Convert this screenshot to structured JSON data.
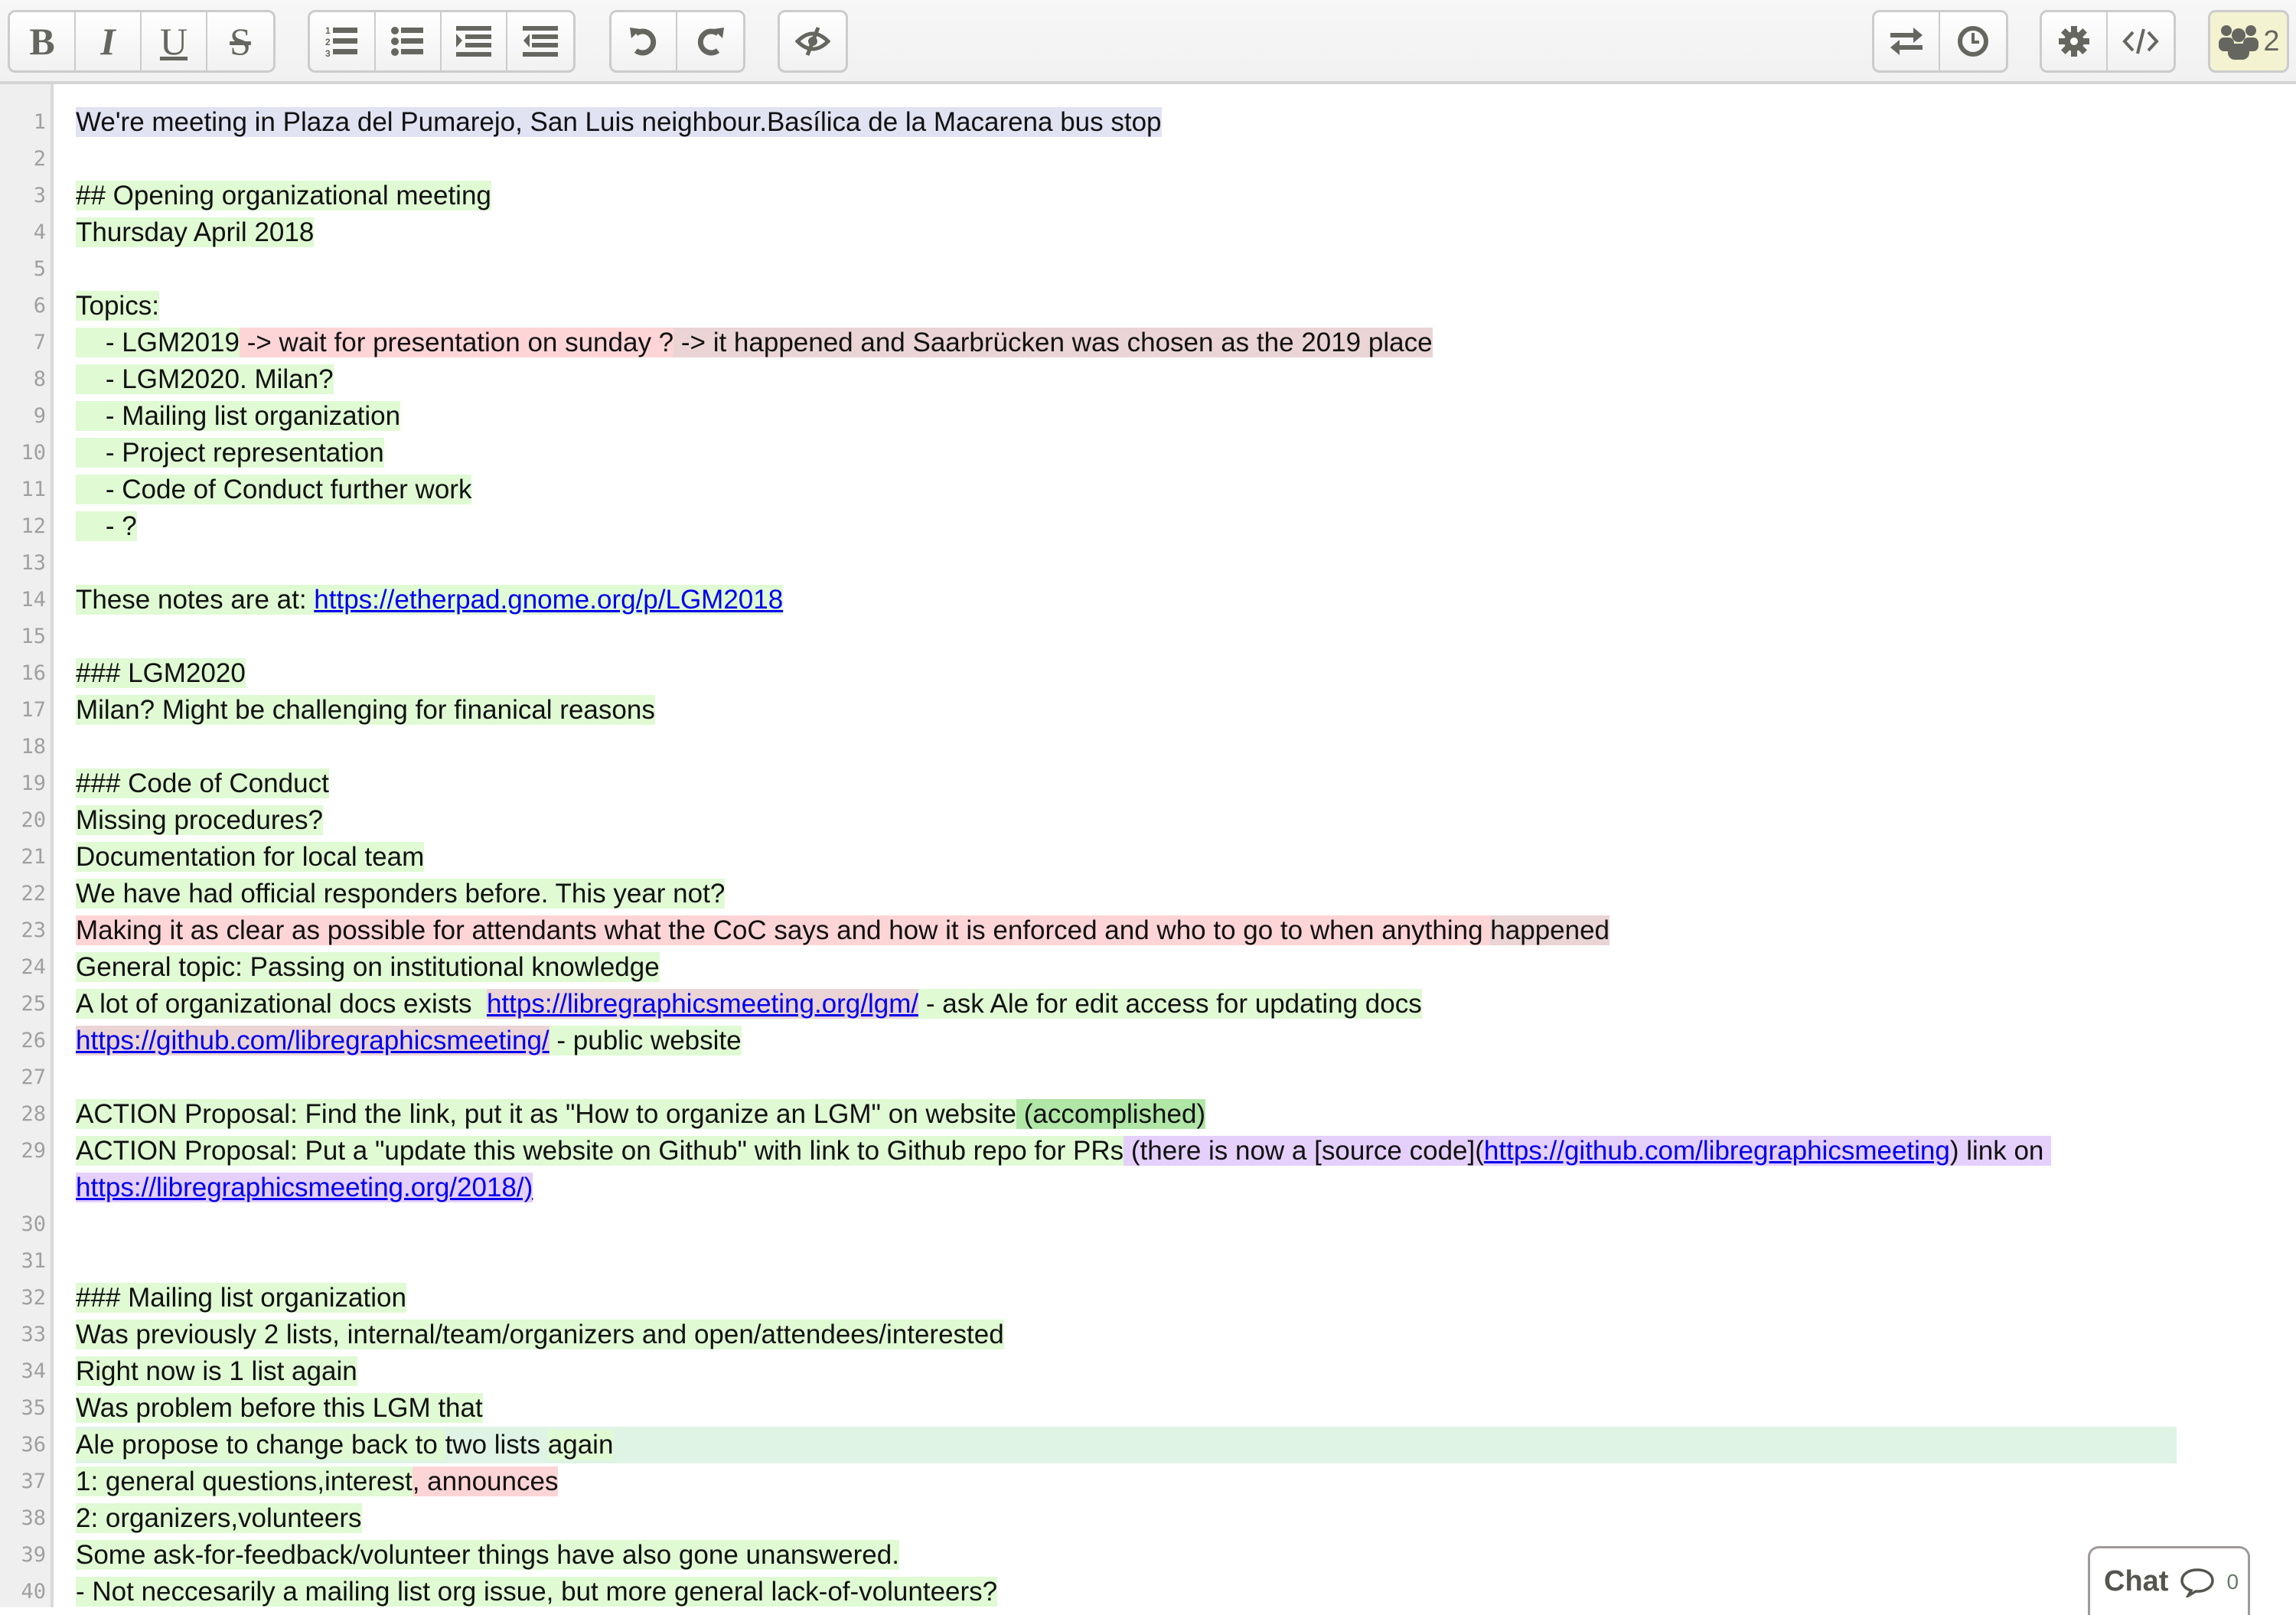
{
  "toolbar": {
    "bold_label": "B",
    "italic_label": "I",
    "underline_label": "U",
    "strike_label": "S",
    "users_count": "2",
    "left_buttons": [
      "bold",
      "italic",
      "underline",
      "strikethrough",
      "ordered-list",
      "unordered-list",
      "indent",
      "outdent",
      "undo",
      "redo",
      "clear-authorship"
    ],
    "right_buttons": [
      "import-export",
      "timeslider",
      "settings",
      "embed",
      "users"
    ]
  },
  "colors": {
    "author_blue": "#e1e2f2",
    "author_green": "#e0fad4",
    "author_pink": "#fed5d6",
    "author_mauve": "#ead4d6",
    "author_dark_green": "#b0e6a6",
    "author_violet": "#e5cffb",
    "author_mint": "#dff4e5",
    "link": "#0000ee"
  },
  "lines": [
    {
      "n": "1",
      "segs": [
        {
          "t": "We're meeting in Plaza del Pumarejo, San Luis neighbour.Basílica de la Macarena bus stop",
          "c": "blue"
        }
      ]
    },
    {
      "n": "2",
      "segs": []
    },
    {
      "n": "3",
      "segs": [
        {
          "t": "## Opening organizational meeting",
          "c": "green"
        }
      ]
    },
    {
      "n": "4",
      "segs": [
        {
          "t": "Thursday April 2018",
          "c": "green"
        }
      ]
    },
    {
      "n": "5",
      "segs": []
    },
    {
      "n": "6",
      "segs": [
        {
          "t": "Topics:",
          "c": "green"
        }
      ]
    },
    {
      "n": "7",
      "segs": [
        {
          "t": "    - LGM2019",
          "c": "green"
        },
        {
          "t": " -> wait for presentation on sunday ?",
          "c": "pink"
        },
        {
          "t": " -> it happened and Saarbrücken was chosen as the 2019 place",
          "c": "mauve"
        }
      ]
    },
    {
      "n": "8",
      "segs": [
        {
          "t": "    - LGM2020. Milan?",
          "c": "green"
        }
      ]
    },
    {
      "n": "9",
      "segs": [
        {
          "t": "    - Mailing list organization",
          "c": "green"
        }
      ]
    },
    {
      "n": "10",
      "segs": [
        {
          "t": "    - Project representation",
          "c": "green"
        }
      ]
    },
    {
      "n": "11",
      "segs": [
        {
          "t": "    - Code of Conduct further work",
          "c": "green"
        }
      ]
    },
    {
      "n": "12",
      "segs": [
        {
          "t": "    - ?",
          "c": "green"
        }
      ]
    },
    {
      "n": "13",
      "segs": []
    },
    {
      "n": "14",
      "segs": [
        {
          "t": "These notes are at: ",
          "c": "green"
        },
        {
          "t": "https://etherpad.gnome.org/p/LGM2018",
          "c": "green",
          "link": true
        }
      ]
    },
    {
      "n": "15",
      "segs": []
    },
    {
      "n": "16",
      "segs": [
        {
          "t": "### LGM2020",
          "c": "green"
        }
      ]
    },
    {
      "n": "17",
      "segs": [
        {
          "t": "Milan? Might be challenging for finanical reasons",
          "c": "green"
        }
      ]
    },
    {
      "n": "18",
      "segs": []
    },
    {
      "n": "19",
      "segs": [
        {
          "t": "### Code of Conduct",
          "c": "green"
        }
      ]
    },
    {
      "n": "20",
      "segs": [
        {
          "t": "Missing procedures?",
          "c": "green"
        }
      ]
    },
    {
      "n": "21",
      "segs": [
        {
          "t": "Documentation for local team",
          "c": "green"
        }
      ]
    },
    {
      "n": "22",
      "segs": [
        {
          "t": "We have had official responders before. This year not?",
          "c": "green"
        }
      ]
    },
    {
      "n": "23",
      "segs": [
        {
          "t": "Making it as clear as possible for attendants what the CoC says and how it is enforced and who to go to when anything ",
          "c": "pink"
        },
        {
          "t": "happened",
          "c": "mauve"
        }
      ]
    },
    {
      "n": "24",
      "segs": [
        {
          "t": "General topic: Passing on institutional knowledge",
          "c": "green"
        }
      ]
    },
    {
      "n": "25",
      "segs": [
        {
          "t": "A lot of organizational docs exists  ",
          "c": "green"
        },
        {
          "t": "https://libregraphicsmeeting.org/lgm/",
          "c": "mauve",
          "link": true
        },
        {
          "t": " - ask Ale for edit access for updating docs",
          "c": "green"
        }
      ]
    },
    {
      "n": "26",
      "segs": [
        {
          "t": "https://github.com/libregraphicsmeeting/",
          "c": "mauve",
          "link": true
        },
        {
          "t": " - public website",
          "c": "green"
        }
      ]
    },
    {
      "n": "27",
      "segs": []
    },
    {
      "n": "28",
      "segs": [
        {
          "t": "ACTION Proposal: Find the link, put it as \"How to organize an LGM\" on website",
          "c": "green"
        },
        {
          "t": " (accomplished)",
          "c": "dgreen"
        }
      ]
    },
    {
      "n": "29",
      "wrap": true,
      "segs": [
        {
          "t": "ACTION Proposal: Put a \"update this website on Github\" with link to Github repo for PRs",
          "c": "green"
        },
        {
          "t": " (there is now a [source code](",
          "c": "violet"
        },
        {
          "t": "https://github.com/libregraphicsmeeting",
          "c": "violet",
          "link": true
        },
        {
          "t": ") link on ",
          "c": "violet"
        },
        {
          "t": "https://libregraphicsmeeting.org/2018/)",
          "c": "violet",
          "link": true
        }
      ]
    },
    {
      "n": "30",
      "segs": []
    },
    {
      "n": "31",
      "segs": []
    },
    {
      "n": "32",
      "segs": [
        {
          "t": "### Mailing list organization",
          "c": "green"
        }
      ]
    },
    {
      "n": "33",
      "segs": [
        {
          "t": "Was previously 2 lists, internal/team/organizers and open/attendees/interested",
          "c": "green"
        }
      ]
    },
    {
      "n": "34",
      "segs": [
        {
          "t": "Right now is 1 list again",
          "c": "green"
        }
      ]
    },
    {
      "n": "35",
      "segs": [
        {
          "t": "Was problem before this LGM that",
          "c": "green"
        }
      ]
    },
    {
      "n": "36",
      "band": true,
      "segs": [
        {
          "t": "Ale propose to change back to ",
          "c": "green"
        },
        {
          "t": "two lists ",
          "c": "mint"
        },
        {
          "t": "again",
          "c": "green"
        }
      ]
    },
    {
      "n": "37",
      "segs": [
        {
          "t": "1: general questions,interest",
          "c": "green"
        },
        {
          "t": ", announces",
          "c": "pink"
        }
      ]
    },
    {
      "n": "38",
      "segs": [
        {
          "t": "2: organizers,volunteers",
          "c": "green"
        }
      ]
    },
    {
      "n": "39",
      "segs": [
        {
          "t": "Some ask-for-feedback/volunteer things have also gone unanswered.",
          "c": "green"
        }
      ]
    },
    {
      "n": "40",
      "segs": [
        {
          "t": "- Not neccesarily a mailing list org issue, but more general lack-of-volunteers?",
          "c": "green"
        }
      ]
    }
  ],
  "chat": {
    "label": "Chat",
    "count": "0"
  }
}
